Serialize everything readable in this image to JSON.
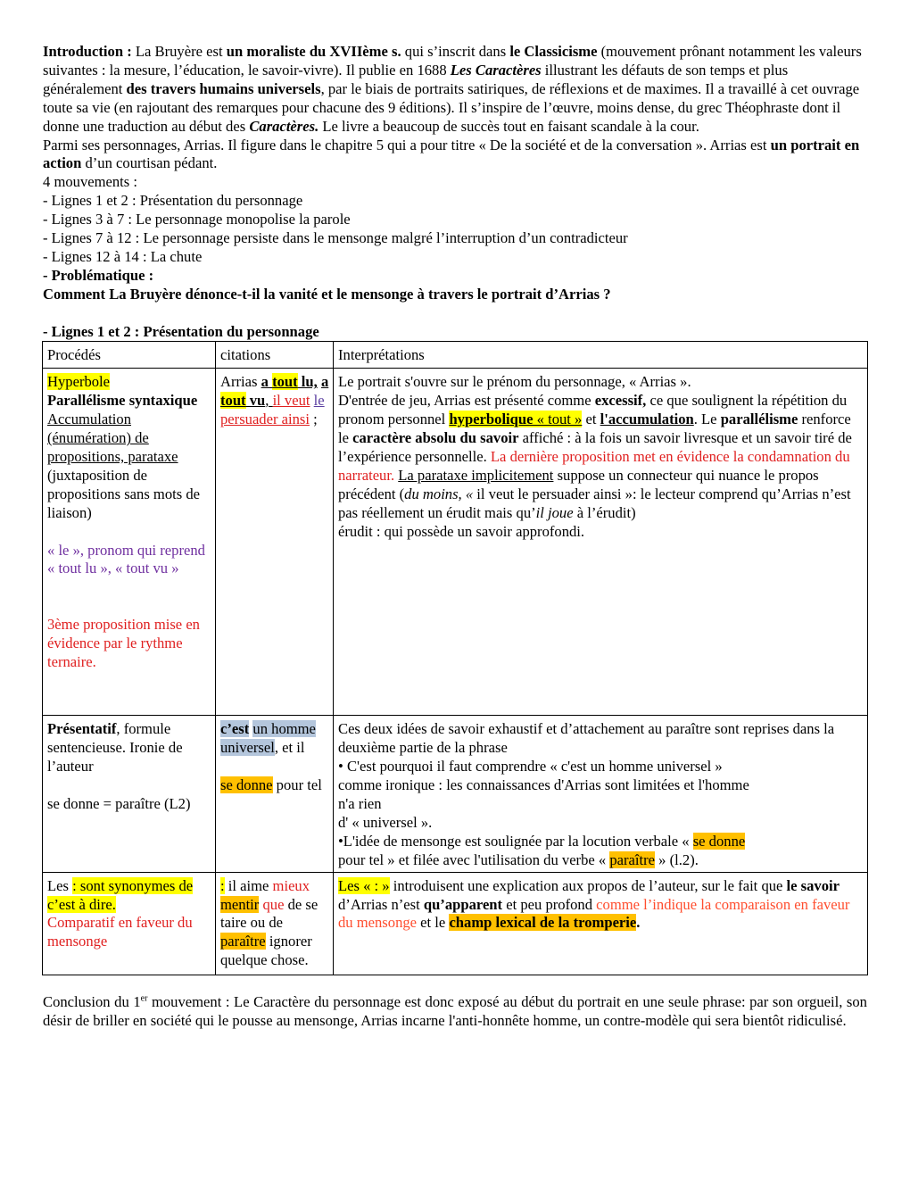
{
  "intro": {
    "label": "Introduction :",
    "t1": " La Bruyère est ",
    "b1": "un moraliste du XVIIème s.",
    "t2": " qui s’inscrit dans ",
    "b2": "le Classicisme",
    "t3": " (mouvement prônant notamment les valeurs suivantes : la mesure, l’éducation, le savoir-vivre). Il publie en 1688 ",
    "bi1": "Les Caractères",
    "t4": " illustrant les défauts de son temps et plus généralement ",
    "b3": "des travers humains universels",
    "t5": ", par le biais de portraits satiriques, de réflexions et de maximes. Il a travaillé à cet ouvrage toute sa vie (en rajoutant des remarques pour chacune des 9 éditions). Il s’inspire de l’œuvre, moins dense, du grec Théophraste dont il donne une traduction au début des ",
    "bi2": "Caractères.",
    "t6": " Le livre a beaucoup de succès tout en faisant scandale à la cour."
  },
  "arrias": {
    "t1": "Parmi ses personnages, Arrias. Il figure dans le chapitre 5 qui a pour titre « De la société et de la conversation ». Arrias est ",
    "b1": "un portrait en action",
    "t2": " d’un courtisan pédant."
  },
  "movements": {
    "heading": "4 mouvements :",
    "items": [
      "- Lignes 1 et 2 : Présentation du personnage",
      "- Lignes 3 à 7 : Le personnage monopolise la parole",
      "- Lignes 7 à 12 : Le personnage persiste dans le mensonge malgré l’interruption d’un contradicteur",
      "- Lignes 12 à 14 : La chute"
    ]
  },
  "problematique": {
    "label": "- Problématique :",
    "question": "Comment La Bruyère dénonce-t-il la vanité et le mensonge à travers le portrait d’Arrias ?"
  },
  "section_title": "- Lignes 1 et 2 : Présentation du personnage",
  "table": {
    "headers": [
      "Procédés",
      "citations",
      "Interprétations"
    ],
    "row1": {
      "proc": {
        "hyperbole": "Hyperbole",
        "parallelisme": "Parallélisme syntaxique",
        "accumulation": "Accumulation (énumération) de propositions, parataxe",
        "juxta": " (juxtaposition de propositions sans mots de liaison)",
        "pronom": "« le », pronom qui reprend « tout lu », « tout vu »",
        "troisieme": "3ème proposition mise en évidence par le rythme ternaire."
      },
      "cit": {
        "arrias": "Arrias ",
        "a1": "a ",
        "tout1": "tout",
        "lu": " lu,",
        "a2": "a ",
        "tout2": "tout",
        "vu": " vu",
        "comma": ", ",
        "il_veut": "il veut",
        "le": "le ",
        "persuader": "persuader ainsi",
        "semi": " ;"
      },
      "interp": {
        "s1": "Le portrait s'ouvre sur le prénom du personnage, « Arrias ».",
        "s2a": "D'entrée de jeu, Arrias est présenté comme ",
        "s2b": "excessif,",
        "s2c": " ce que soulignent la répétition du pronom personnel ",
        "s2d": "hyperbolique",
        "s2e": " « tout »",
        "s2f": " et ",
        "s2g": "l'accumulation",
        "s2h": ". Le ",
        "s2i": "parallélisme",
        "s2j": " renforce le ",
        "s2k": "caractère absolu du savoir",
        "s2l": " affiché : à la fois un savoir livresque et un savoir tiré de l’expérience personnelle. ",
        "s2m": "La dernière proposition met en évidence la condamnation du narrateur.",
        "s2n": " ",
        "s2o": "La parataxe implicitement",
        "s2p": " suppose un connecteur qui nuance le propos précédent (",
        "s2q": "du moins, «",
        "s2r": " il veut le persuader ainsi »: le lecteur comprend qu’Arrias n’est pas réellement un érudit mais qu’",
        "s2s": "il joue",
        "s2t": " à l’érudit)",
        "s3": "érudit : qui possède un savoir approfondi."
      }
    },
    "row2": {
      "proc": {
        "presentatif": "Présentatif",
        "rest": ", formule sentencieuse. Ironie de l’auteur",
        "sedonne": "se donne = paraître (L2)"
      },
      "cit": {
        "cest": "c’est",
        "sp": " ",
        "homme": "un homme universel",
        "etil": ", et il",
        "sedonne": "se donne",
        "pourtel": " pour tel"
      },
      "interp": {
        "p1": "Ces deux idées de savoir exhaustif et d’attachement au paraître sont reprises dans la deuxième partie de la phrase",
        "p2": "• C'est pourquoi il faut comprendre « c'est un homme universel »",
        "p3": "comme ironique : les connaissances d'Arrias sont limitées et l'homme",
        "p4": "n'a rien",
        "p5": "d' « universel ».",
        "p6a": "•L'idée de mensonge est soulignée par la locution verbale « ",
        "p6b": "se donne",
        "p7a": "pour tel » et filée avec l'utilisation du verbe « ",
        "p7b": "paraître",
        "p7c": " » (l.2)."
      }
    },
    "row3": {
      "proc": {
        "les": "Les ",
        "syn": ": sont synonymes de c’est à dire.",
        "comparatif": "Comparatif en faveur du mensonge"
      },
      "cit": {
        "colon": ":",
        "ilaime": " il aime ",
        "mieux": "mieux",
        "sp": " ",
        "mentir": "mentir",
        "que": " que",
        "dese": " de se taire ou de ",
        "paraitre": "paraître",
        "ignorer": " ignorer quelque chose."
      },
      "interp": {
        "les": "Les « : »",
        "t1": " introduisent une explication aux propos de l’auteur, sur le fait que ",
        "b1": "le savoir",
        "t2": " d’Arrias n’est ",
        "b2": "qu’apparent",
        "t3": " et peu profond ",
        "r1": "comme l’indique la comparaison en faveur du mensonge",
        "t4": " et le ",
        "b3": "champ lexical de la tromperie",
        "t5": "."
      }
    }
  },
  "conclusion": {
    "label": "Conclusion du 1",
    "sup": "er",
    "text": " mouvement :  Le Caractère du personnage est donc exposé au début du portrait en une seule phrase: par son orgueil, son désir de briller en société qui le pousse au mensonge, Arrias incarne l'anti-honnête homme, un contre-modèle qui sera bientôt ridiculisé."
  }
}
